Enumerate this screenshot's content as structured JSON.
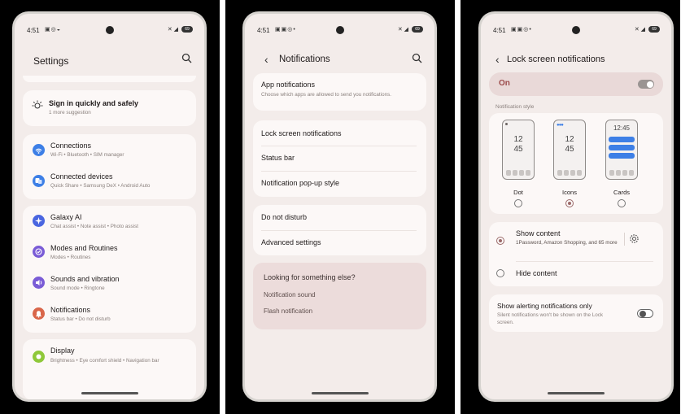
{
  "status": {
    "time": "4:51"
  },
  "screen1": {
    "title": "Settings",
    "suggestion": {
      "title": "Sign in quickly and safely",
      "sub": "1 more suggestion"
    },
    "items": [
      {
        "label": "Connections",
        "sub": "Wi-Fi  •  Bluetooth  •  SIM manager",
        "color": "#3d7fe6"
      },
      {
        "label": "Connected devices",
        "sub": "Quick Share  •  Samsung DeX  •  Android Auto",
        "color": "#3d7fe6"
      },
      {
        "label": "Galaxy AI",
        "sub": "Chat assist  •  Note assist  •  Photo assist",
        "color": "#4a66e0"
      },
      {
        "label": "Modes and Routines",
        "sub": "Modes  •  Routines",
        "color": "#7a5cd6"
      },
      {
        "label": "Sounds and vibration",
        "sub": "Sound mode  •  Ringtone",
        "color": "#7a5cd6"
      },
      {
        "label": "Notifications",
        "sub": "Status bar  •  Do not disturb",
        "color": "#d9664a"
      },
      {
        "label": "Display",
        "sub": "Brightness  •  Eye comfort shield  •  Navigation bar",
        "color": "#8fc83a"
      }
    ]
  },
  "screen2": {
    "title": "Notifications",
    "app_notifications": {
      "label": "App notifications",
      "sub": "Choose which apps are allowed to send you notifications."
    },
    "group2": [
      "Lock screen notifications",
      "Status bar",
      "Notification pop-up style"
    ],
    "group3": [
      "Do not disturb",
      "Advanced settings"
    ],
    "looking": {
      "title": "Looking for something else?",
      "links": [
        "Notification sound",
        "Flash notification"
      ]
    }
  },
  "screen3": {
    "title": "Lock screen notifications",
    "on_label": "On",
    "on_state": true,
    "section_label": "Notification style",
    "styles": [
      {
        "label": "Dot",
        "clock": "12\n45",
        "selected": false
      },
      {
        "label": "Icons",
        "clock": "12\n45",
        "selected": true
      },
      {
        "label": "Cards",
        "clock": "12:45",
        "selected": false
      }
    ],
    "show_content": {
      "label": "Show content",
      "sub": "1Password, Amazon Shopping, and 65 more",
      "selected": true
    },
    "hide_content": {
      "label": "Hide content",
      "selected": false
    },
    "alerting": {
      "label": "Show alerting notifications only",
      "sub": "Silent notifications won't be shown on the Lock screen.",
      "state": false
    },
    "accent": "#9b4a4a"
  }
}
